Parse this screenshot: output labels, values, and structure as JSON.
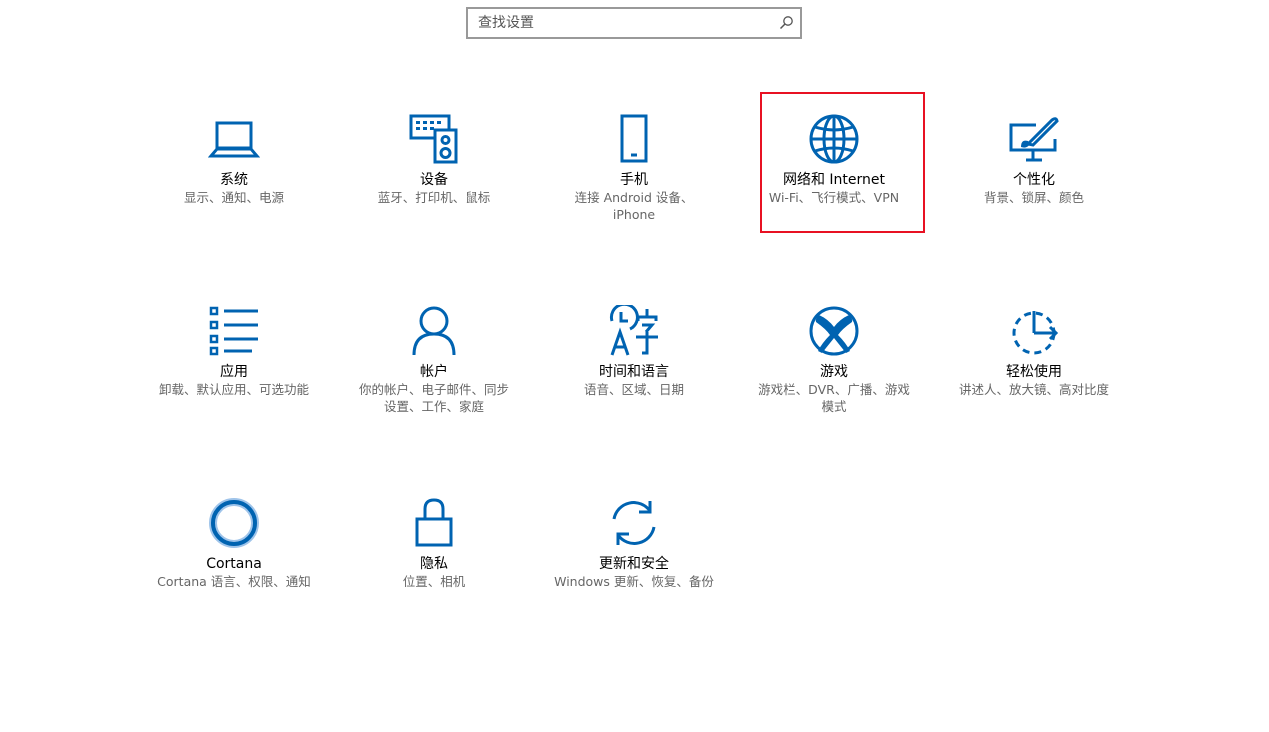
{
  "search": {
    "placeholder": "查找设置"
  },
  "accent_color": "#0063b1",
  "highlight_color": "#e81123",
  "tiles": [
    {
      "icon": "laptop-icon",
      "title": "系统",
      "desc": "显示、通知、电源"
    },
    {
      "icon": "keyboard-speaker-icon",
      "title": "设备",
      "desc": "蓝牙、打印机、鼠标"
    },
    {
      "icon": "phone-icon",
      "title": "手机",
      "desc": "连接 Android 设备、iPhone"
    },
    {
      "icon": "globe-icon",
      "title": "网络和 Internet",
      "desc": "Wi-Fi、飞行模式、VPN"
    },
    {
      "icon": "paint-monitor-icon",
      "title": "个性化",
      "desc": "背景、锁屏、颜色"
    },
    {
      "icon": "app-list-icon",
      "title": "应用",
      "desc": "卸载、默认应用、可选功能"
    },
    {
      "icon": "person-icon",
      "title": "帐户",
      "desc": "你的帐户、电子邮件、同步设置、工作、家庭"
    },
    {
      "icon": "time-language-icon",
      "title": "时间和语言",
      "desc": "语音、区域、日期"
    },
    {
      "icon": "xbox-icon",
      "title": "游戏",
      "desc": "游戏栏、DVR、广播、游戏模式"
    },
    {
      "icon": "ease-of-access-icon",
      "title": "轻松使用",
      "desc": "讲述人、放大镜、高对比度"
    },
    {
      "icon": "cortana-icon",
      "title": "Cortana",
      "desc": "Cortana 语言、权限、通知"
    },
    {
      "icon": "lock-icon",
      "title": "隐私",
      "desc": "位置、相机"
    },
    {
      "icon": "sync-icon",
      "title": "更新和安全",
      "desc": "Windows 更新、恢复、备份"
    }
  ]
}
